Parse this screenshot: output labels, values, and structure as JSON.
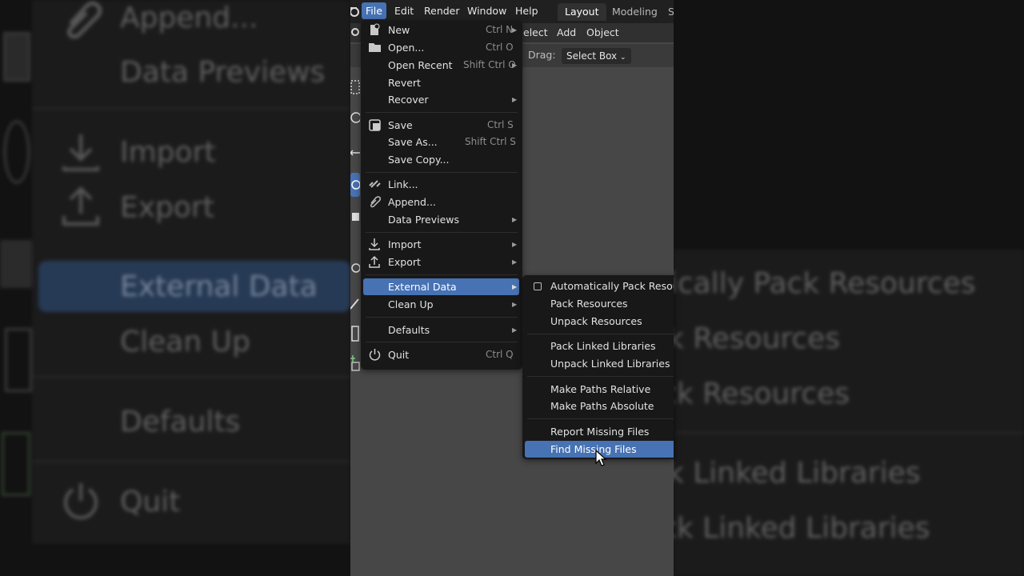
{
  "topbar": {
    "menus": [
      "File",
      "Edit",
      "Render",
      "Window",
      "Help"
    ],
    "workspaces": [
      "Layout",
      "Modeling",
      "S"
    ]
  },
  "header": {
    "items": [
      "elect",
      "Add",
      "Object"
    ],
    "drag_label": "Drag:",
    "drag_value": "Select Box"
  },
  "file_menu": {
    "items": [
      {
        "label": "New",
        "shortcut": "Ctrl N",
        "icon": "new-file-icon",
        "submenu": true
      },
      {
        "label": "Open...",
        "shortcut": "Ctrl O",
        "icon": "folder-icon"
      },
      {
        "label": "Open Recent",
        "shortcut": "Shift Ctrl O",
        "submenu": true
      },
      {
        "label": "Revert"
      },
      {
        "label": "Recover",
        "submenu": true
      },
      {
        "label": "Save",
        "shortcut": "Ctrl S",
        "icon": "save-icon"
      },
      {
        "label": "Save As...",
        "shortcut": "Shift Ctrl S"
      },
      {
        "label": "Save Copy..."
      },
      {
        "label": "Link...",
        "icon": "link-icon"
      },
      {
        "label": "Append...",
        "icon": "paperclip-icon"
      },
      {
        "label": "Data Previews",
        "submenu": true
      },
      {
        "label": "Import",
        "icon": "import-icon",
        "submenu": true
      },
      {
        "label": "Export",
        "icon": "export-icon",
        "submenu": true
      },
      {
        "label": "External Data",
        "submenu": true,
        "highlighted": true
      },
      {
        "label": "Clean Up",
        "submenu": true
      },
      {
        "label": "Defaults",
        "submenu": true
      },
      {
        "label": "Quit",
        "shortcut": "Ctrl Q",
        "icon": "power-icon"
      }
    ]
  },
  "external_data_menu": {
    "items": [
      {
        "label": "Automatically Pack Resources",
        "checkbox": true,
        "checked": false
      },
      {
        "label": "Pack Resources"
      },
      {
        "label": "Unpack Resources"
      },
      {
        "label": "Pack Linked Libraries"
      },
      {
        "label": "Unpack Linked Libraries"
      },
      {
        "label": "Make Paths Relative"
      },
      {
        "label": "Make Paths Absolute"
      },
      {
        "label": "Report Missing Files"
      },
      {
        "label": "Find Missing Files",
        "highlighted": true
      }
    ]
  },
  "background_left": [
    "Append...",
    "Data Previews",
    "Import",
    "Export",
    "External Data",
    "Clean Up",
    "Defaults",
    "Quit"
  ],
  "background_right": [
    "Automatically Pack Resources",
    "Pack Resources",
    "Unpack Resources",
    "Pack Linked Libraries",
    "Unpack Linked Libraries"
  ],
  "colors": {
    "highlight": "#4772b3",
    "menu_bg": "#181818",
    "viewport_bg": "#474747"
  }
}
